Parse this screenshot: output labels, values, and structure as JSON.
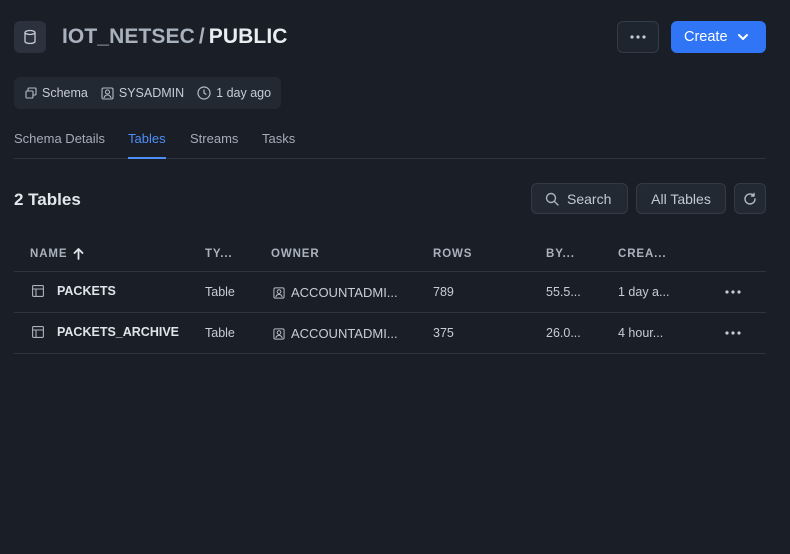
{
  "header": {
    "database": "IOT_NETSEC",
    "separator": "/",
    "schema": "PUBLIC",
    "create_label": "Create"
  },
  "meta": {
    "type_label": "Schema",
    "owner": "SYSADMIN",
    "created": "1 day ago"
  },
  "tabs": [
    {
      "label": "Schema Details"
    },
    {
      "label": "Tables"
    },
    {
      "label": "Streams"
    },
    {
      "label": "Tasks"
    }
  ],
  "active_tab": "Tables",
  "toolbar": {
    "count_label": "2 Tables",
    "search_label": "Search",
    "filter_label": "All Tables"
  },
  "table": {
    "columns": [
      "NAME",
      "TY...",
      "OWNER",
      "ROWS",
      "BY...",
      "CREA..."
    ],
    "sort": {
      "column": "NAME",
      "direction": "ascending"
    },
    "rows": [
      {
        "name": "PACKETS",
        "type": "Table",
        "owner": "ACCOUNTADMI...",
        "rows": "789",
        "bytes": "55.5...",
        "created": "1 day a..."
      },
      {
        "name": "PACKETS_ARCHIVE",
        "type": "Table",
        "owner": "ACCOUNTADMI...",
        "rows": "375",
        "bytes": "26.0...",
        "created": "4 hour..."
      }
    ]
  },
  "icons": {
    "database": "database-icon",
    "more": "more-horizontal-icon",
    "create_dropdown": "chevron-down-icon",
    "schema": "schema-icon",
    "owner": "user-icon",
    "time": "clock-icon",
    "search": "search-icon",
    "refresh": "refresh-icon",
    "sort": "arrow-up-icon",
    "table": "table-icon"
  },
  "colors": {
    "background": "#1a1f27",
    "accent": "#2f75f6",
    "active_tab": "#4f8df7"
  }
}
